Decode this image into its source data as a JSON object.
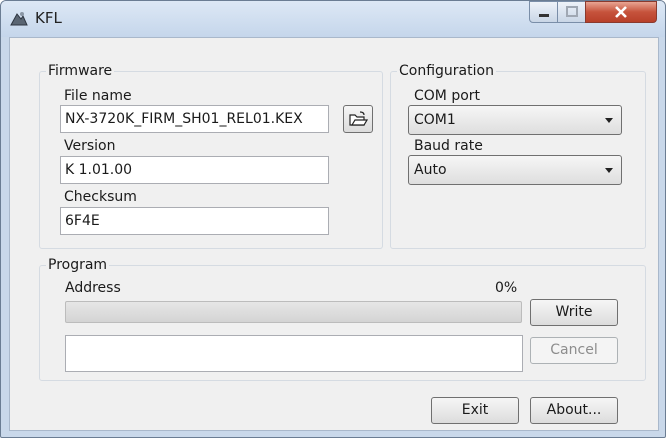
{
  "window": {
    "title": "KFL",
    "icon": "app-icon"
  },
  "firmware": {
    "legend": "Firmware",
    "file_name_label": "File name",
    "file_name_value": "NX-3720K_FIRM_SH01_REL01.KEX",
    "browse_icon": "open-folder-icon",
    "version_label": "Version",
    "version_value": "K 1.01.00",
    "checksum_label": "Checksum",
    "checksum_value": "6F4E"
  },
  "configuration": {
    "legend": "Configuration",
    "com_port_label": "COM port",
    "com_port_value": "COM1",
    "baud_rate_label": "Baud rate",
    "baud_rate_value": "Auto"
  },
  "program": {
    "legend": "Program",
    "address_label": "Address",
    "progress_text": "0%",
    "progress_value": 0,
    "log_text": "",
    "write_label": "Write",
    "cancel_label": "Cancel"
  },
  "footer": {
    "exit_label": "Exit",
    "about_label": "About..."
  }
}
